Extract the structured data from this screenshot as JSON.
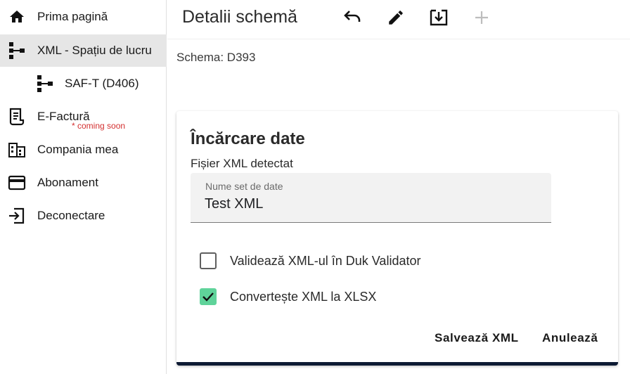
{
  "sidebar": {
    "items": [
      {
        "label": "Prima pagină",
        "icon": "home-icon"
      },
      {
        "label": "XML - Spațiu de lucru",
        "icon": "schema-tree-icon",
        "active": true
      },
      {
        "label": "SAF-T (D406)",
        "icon": "schema-tree-icon"
      },
      {
        "label": "E-Factură",
        "icon": "receipt-icon",
        "note": "* coming soon"
      },
      {
        "label": "Compania mea",
        "icon": "building-icon"
      },
      {
        "label": "Abonament",
        "icon": "credit-card-icon"
      },
      {
        "label": "Deconectare",
        "icon": "logout-icon"
      }
    ]
  },
  "header": {
    "title": "Detalii schemă",
    "tools": [
      "undo-icon",
      "edit-pencil-icon",
      "download-icon",
      "add-plus-icon"
    ]
  },
  "schema": {
    "label": "Schema: D393"
  },
  "card": {
    "title": "Încărcare date",
    "subtitle": "Fișier XML detectat",
    "dataset_field": {
      "label": "Nume set de date",
      "value": "Test XML"
    },
    "options": [
      {
        "label": "Validează XML-ul în Duk Validator",
        "checked": false
      },
      {
        "label": "Convertește XML la XLSX",
        "checked": true
      }
    ],
    "save_label": "Salvează XML",
    "cancel_label": "Anulează"
  },
  "colors": {
    "accent_check": "#5fd39a",
    "card_bottom_bar": "#0d1a33",
    "active_nav_bg": "#e6e6e6",
    "coming_soon": "#d32f2f"
  }
}
